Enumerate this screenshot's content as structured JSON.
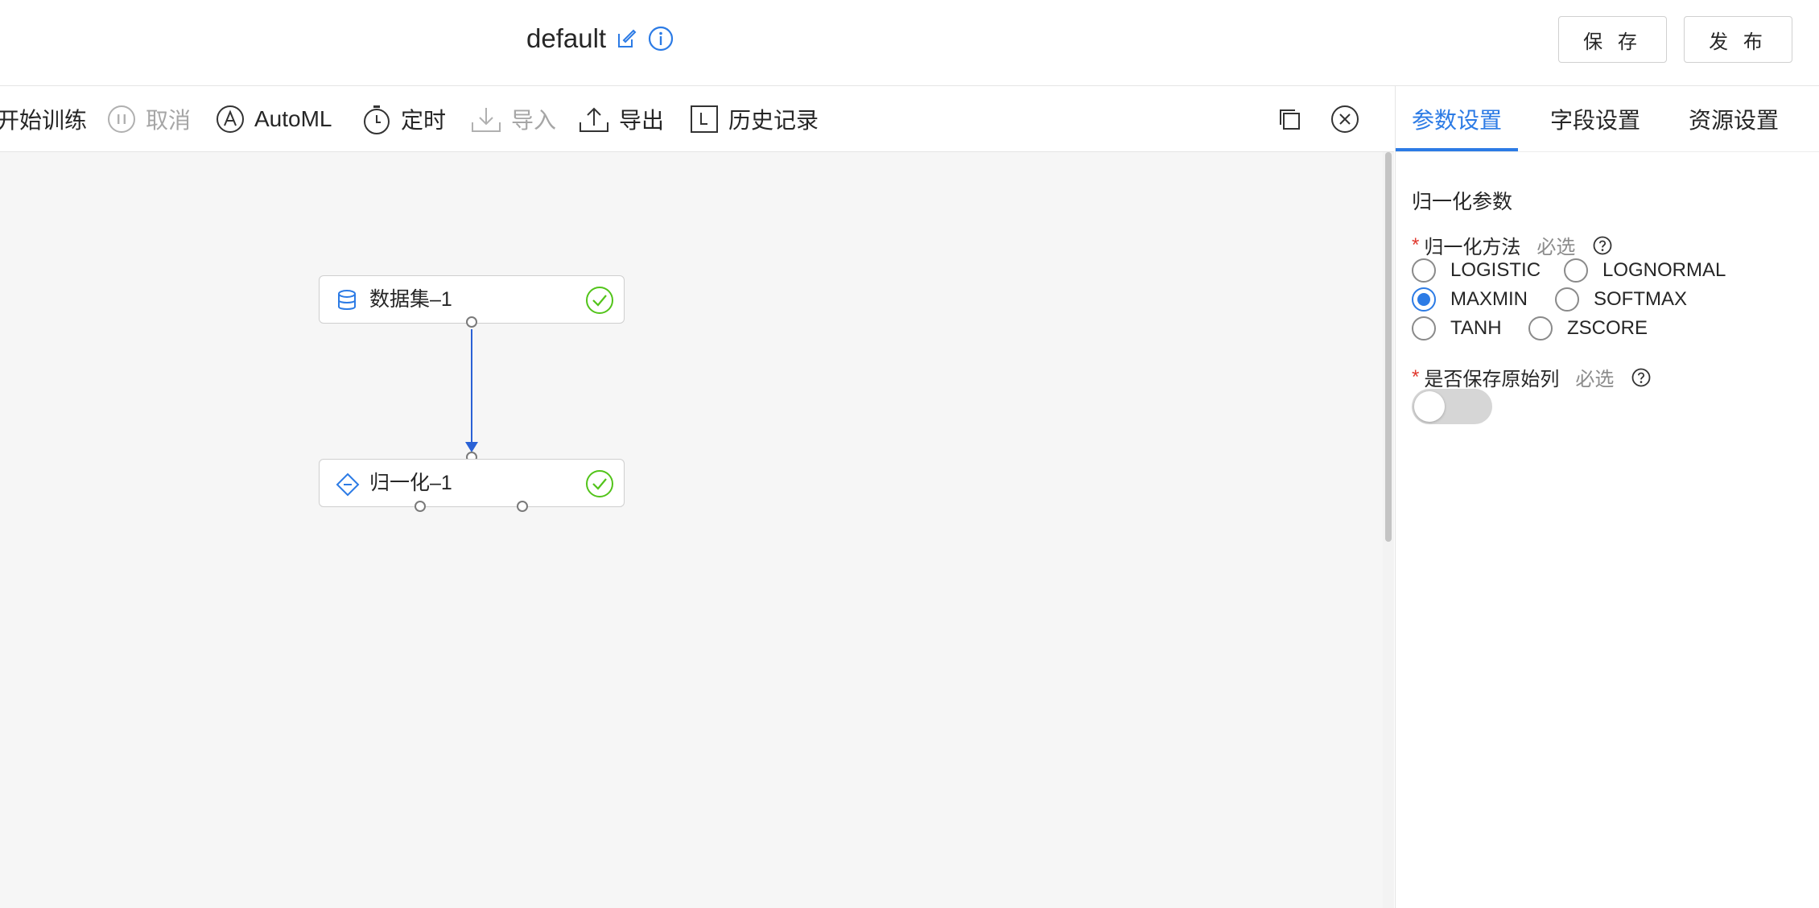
{
  "header": {
    "title": "default",
    "save_label": "保 存",
    "publish_label": "发 布"
  },
  "toolbar": {
    "start_training": "开始训练",
    "cancel": "取消",
    "automl": "AutoML",
    "schedule": "定时",
    "import": "导入",
    "export": "导出",
    "history": "历史记录"
  },
  "canvas": {
    "nodes": [
      {
        "label": "数据集–1",
        "icon": "database-icon",
        "status": "success"
      },
      {
        "label": "归一化–1",
        "icon": "normalize-icon",
        "status": "success"
      }
    ]
  },
  "panel": {
    "tabs": [
      {
        "label": "参数设置",
        "active": true
      },
      {
        "label": "字段设置",
        "active": false
      },
      {
        "label": "资源设置",
        "active": false
      }
    ],
    "section_title": "归一化参数",
    "method_field": {
      "required_mark": "*",
      "label": "归一化方法",
      "hint": "必选",
      "options": [
        "LOGISTIC",
        "LOGNORMAL",
        "MAXMIN",
        "SOFTMAX",
        "TANH",
        "ZSCORE"
      ],
      "selected": "MAXMIN"
    },
    "keep_field": {
      "required_mark": "*",
      "label": "是否保存原始列",
      "hint": "必选",
      "value": false
    }
  },
  "colors": {
    "accent": "#2c7be5",
    "success": "#52c41a",
    "required": "#e0382e"
  }
}
